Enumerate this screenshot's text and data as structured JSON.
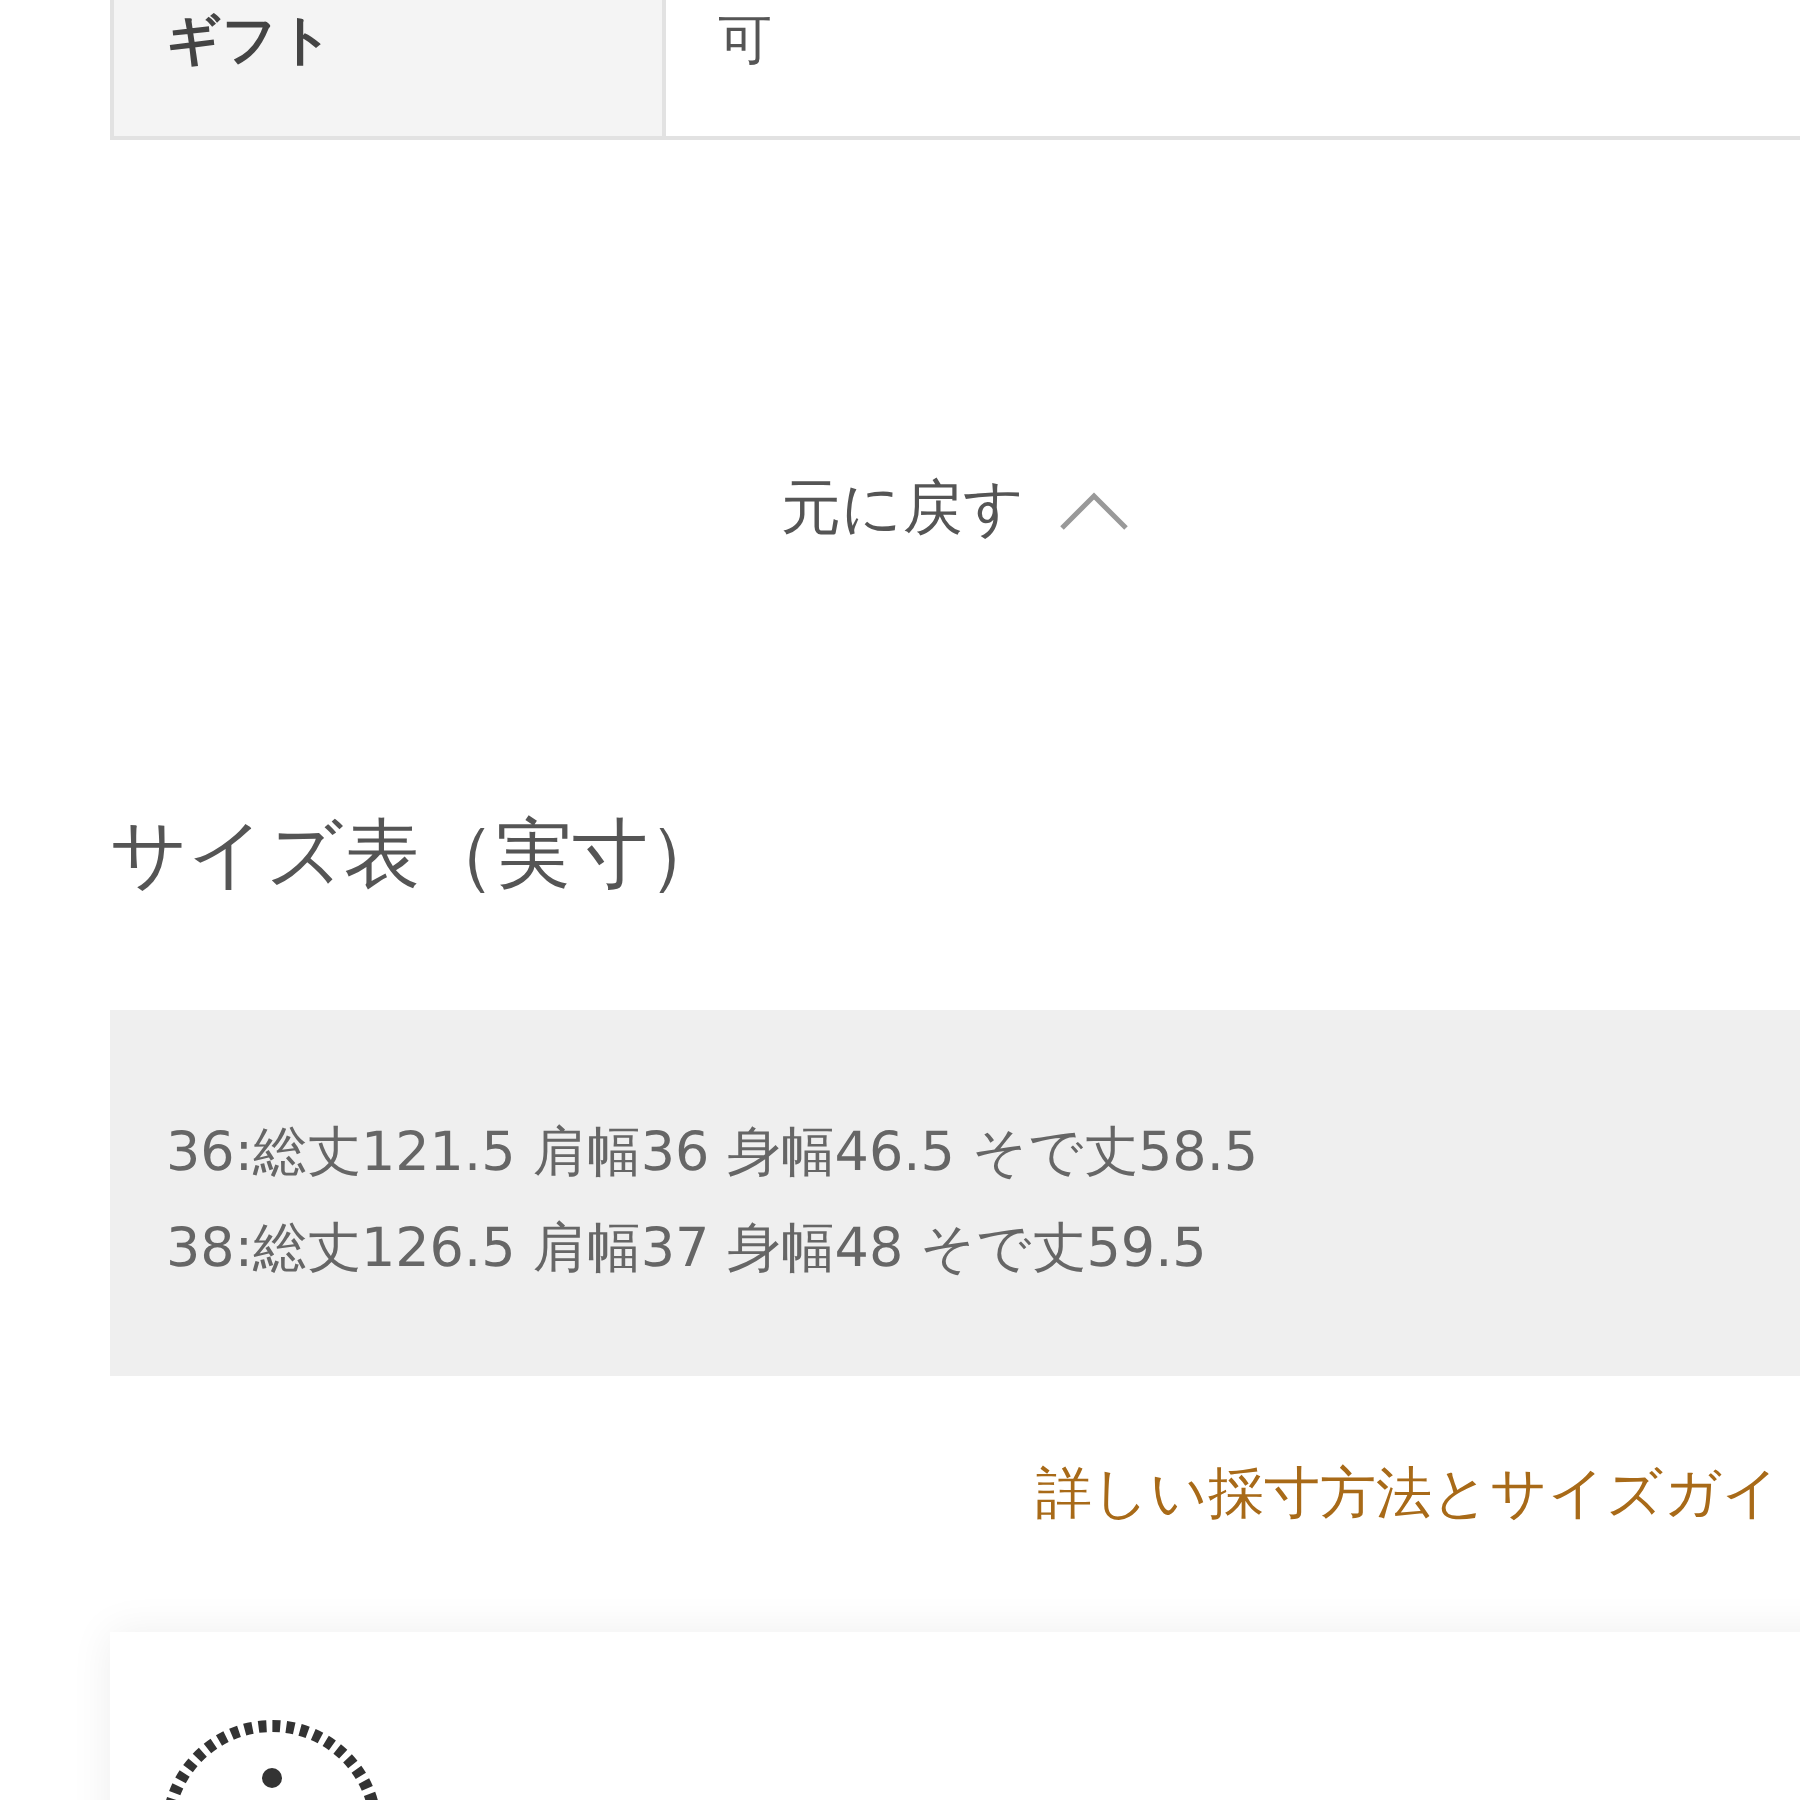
{
  "spec_table": {
    "rows": [
      {
        "label": "ギフト",
        "value": "可"
      }
    ]
  },
  "collapse_button": {
    "label": "元に戻す"
  },
  "size_chart": {
    "title": "サイズ表（実寸）",
    "lines": [
      "36:総丈121.5 肩幅36 身幅46.5 そで丈58.5",
      "38:総丈126.5 肩幅37 身幅48 そで丈59.5"
    ]
  },
  "size_guide_link": {
    "label": "詳しい採寸方法とサイズガイ"
  }
}
